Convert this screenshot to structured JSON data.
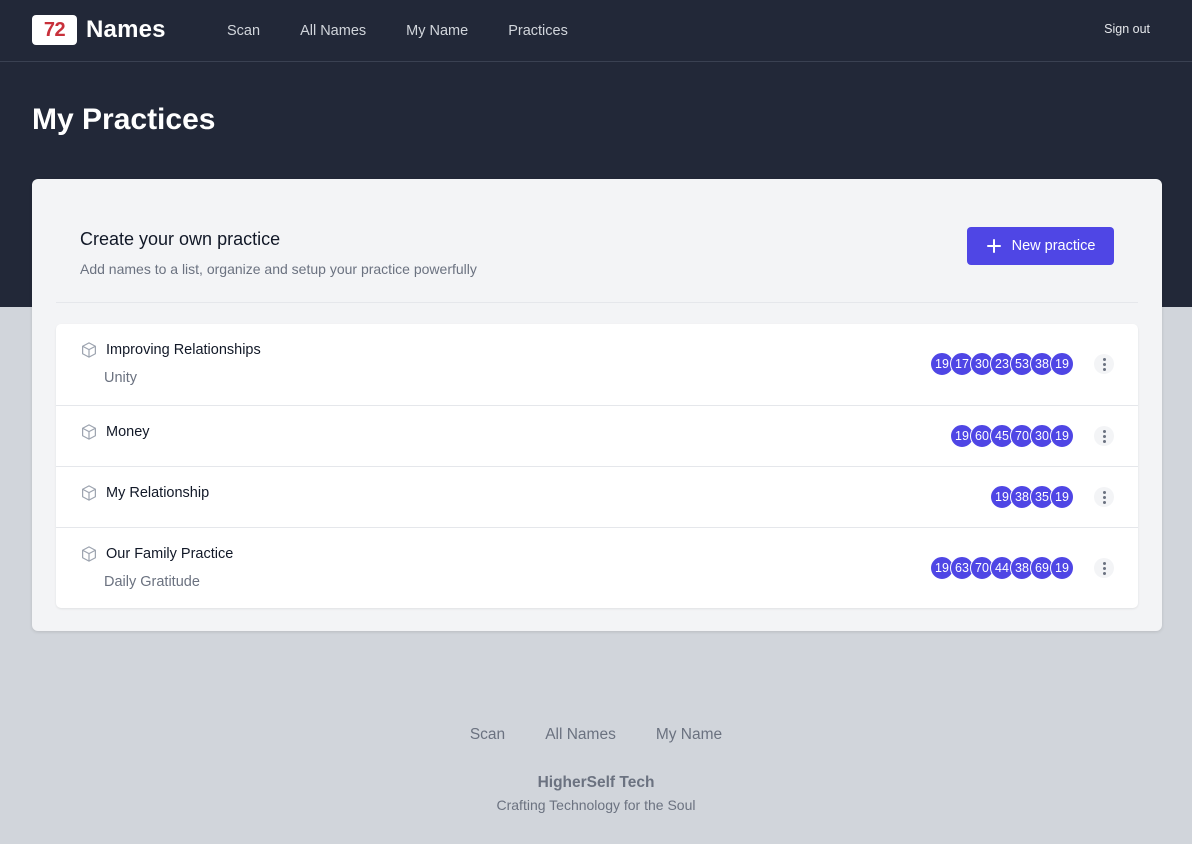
{
  "brand": {
    "badge": "72",
    "word": "Names"
  },
  "nav": {
    "links": [
      "Scan",
      "All Names",
      "My Name",
      "Practices"
    ],
    "signout": "Sign out"
  },
  "page": {
    "title": "My Practices"
  },
  "card": {
    "title": "Create your own practice",
    "subtitle": "Add names to a list, organize and setup your practice powerfully",
    "new_button": "New practice",
    "accent": "#4f46e5"
  },
  "practices": [
    {
      "name": "Improving Relationships",
      "subtitle": "Unity",
      "names": [
        "19",
        "17",
        "30",
        "23",
        "53",
        "38",
        "19"
      ]
    },
    {
      "name": "Money",
      "subtitle": "",
      "names": [
        "19",
        "60",
        "45",
        "70",
        "30",
        "19"
      ]
    },
    {
      "name": "My Relationship",
      "subtitle": "",
      "names": [
        "19",
        "38",
        "35",
        "19"
      ]
    },
    {
      "name": "Our Family Practice",
      "subtitle": "Daily Gratitude",
      "names": [
        "19",
        "63",
        "70",
        "44",
        "38",
        "69",
        "19"
      ]
    }
  ],
  "footer": {
    "links": [
      "Scan",
      "All Names",
      "My Name"
    ],
    "company": "HigherSelf Tech",
    "tagline": "Crafting Technology for the Soul"
  }
}
